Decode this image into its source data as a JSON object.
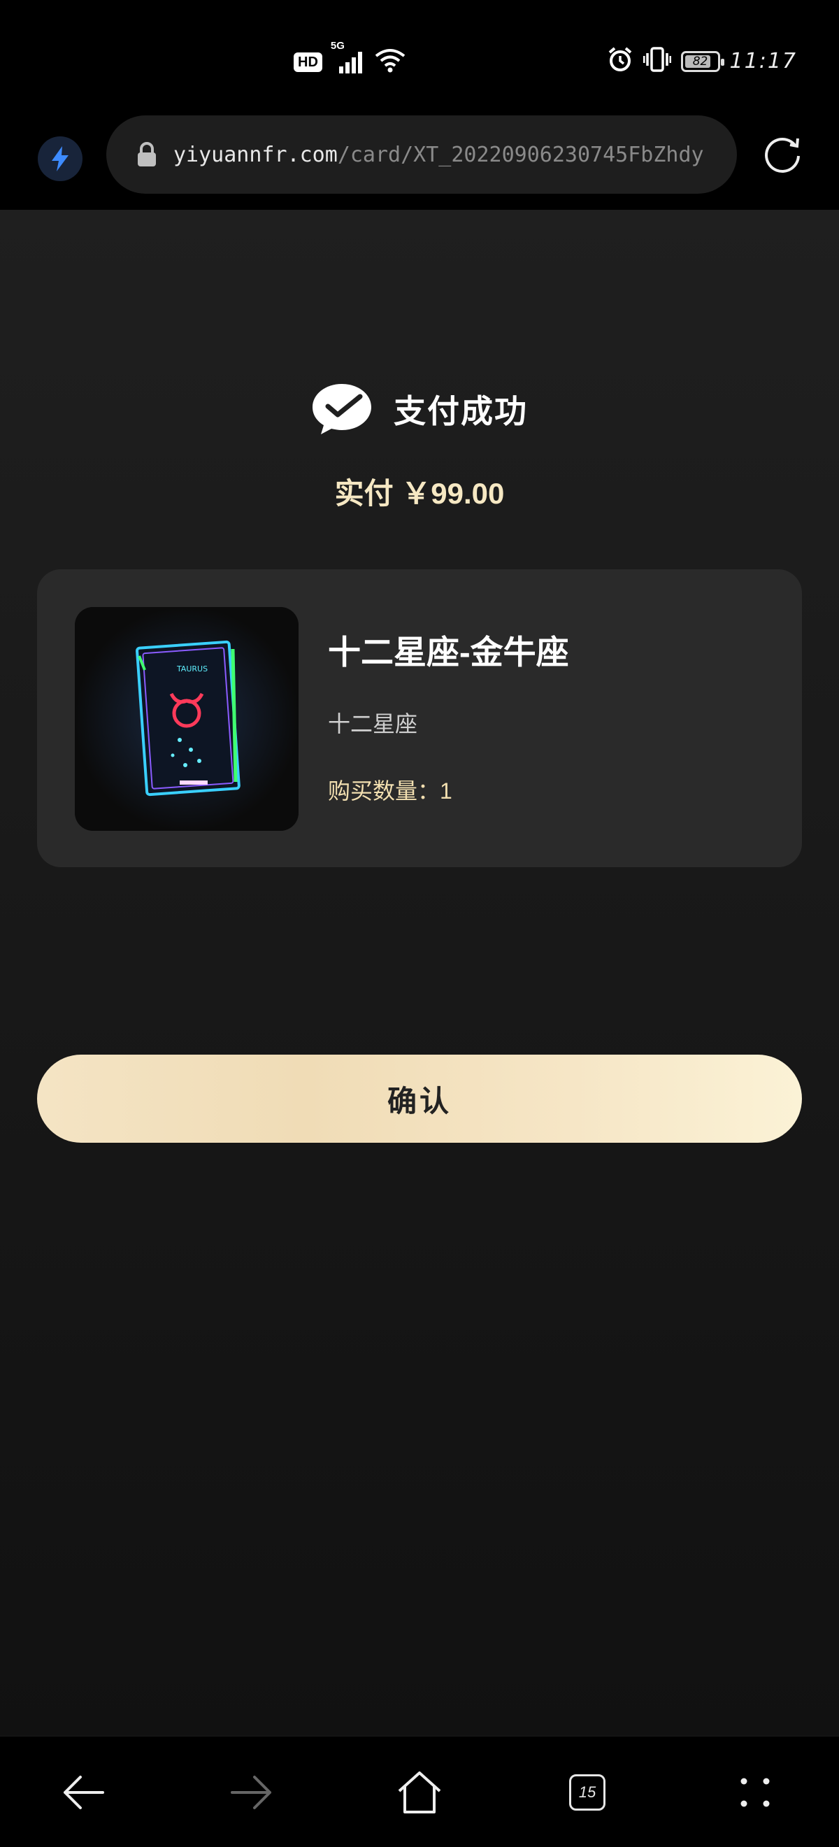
{
  "status_bar": {
    "hd_label": "HD",
    "network_label": "5G",
    "battery_level": "82",
    "battery_fraction": 0.82,
    "time": "11:17"
  },
  "browser": {
    "url_domain": "yiyuannfr.com",
    "url_path": "/card/XT_20220906230745FbZhdy",
    "tab_count": "15"
  },
  "payment": {
    "status_title": "支付成功",
    "paid_label": "实付",
    "paid_amount": "￥99.00"
  },
  "product": {
    "name": "十二星座-金牛座",
    "category": "十二星座",
    "quantity_label": "购买数量：",
    "quantity": "1",
    "thumb_caption": "TAURUS"
  },
  "actions": {
    "confirm_label": "确认"
  },
  "colors": {
    "accent_gold": "#f6e8c3",
    "button_gradient_start": "#f4e4c4",
    "button_gradient_end": "#fbf2d6",
    "card_bg": "#2a2a2a",
    "page_bg": "#121212"
  }
}
